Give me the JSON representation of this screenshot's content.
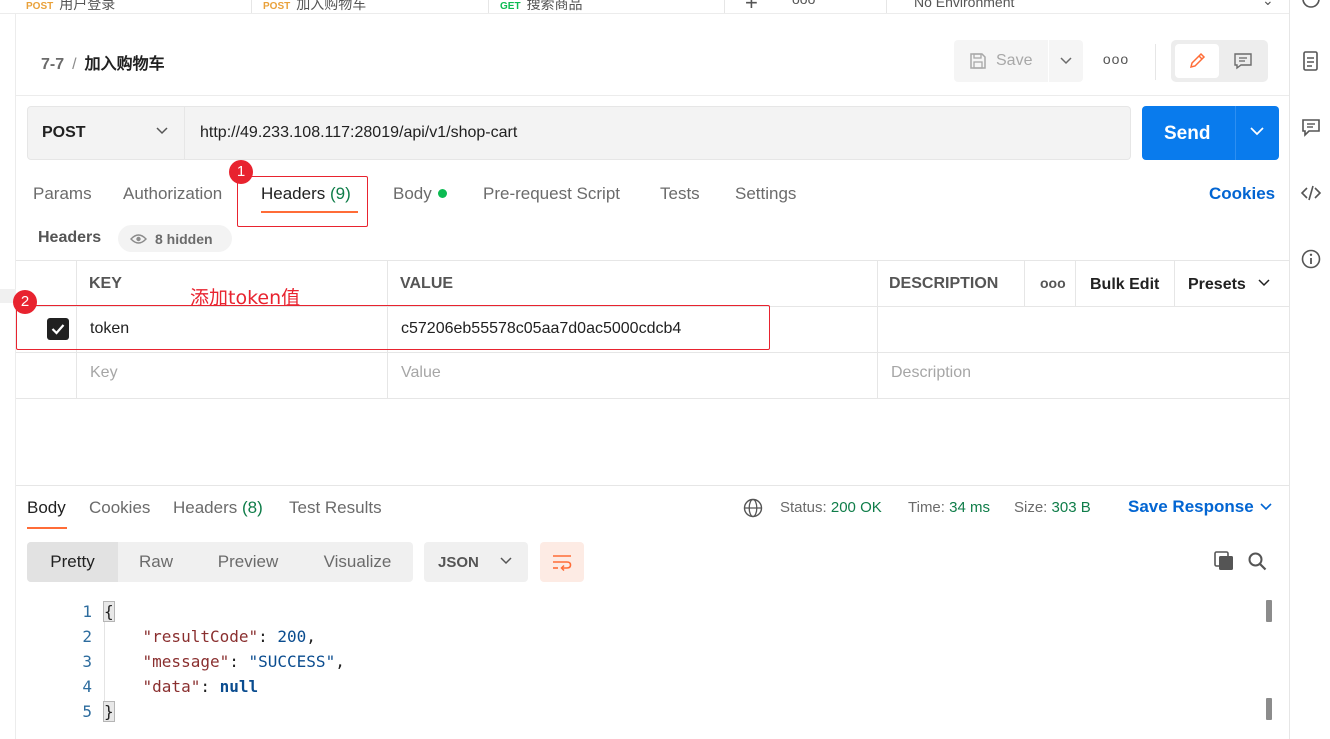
{
  "tabstrip": {
    "tabs": [
      {
        "method": "POST",
        "name": "用户登录",
        "method_color": "#e9a13a"
      },
      {
        "method": "POST",
        "name": "加入购物车",
        "method_color": "#e9a13a"
      },
      {
        "method": "GET",
        "name": "搜索商品",
        "method_color": "#0cbb52"
      }
    ],
    "new_tab_icon": "plus-icon",
    "more_icon": "ellipsis-icon",
    "environment": "No Environment"
  },
  "breadcrumb": {
    "collection": "7-7",
    "request": "加入购物车"
  },
  "toolbar": {
    "save_label": "Save"
  },
  "request": {
    "method": "POST",
    "url": "http://49.233.108.117:28019/api/v1/shop-cart",
    "send_label": "Send"
  },
  "request_tabs": {
    "params": "Params",
    "authorization": "Authorization",
    "headers": "Headers",
    "headers_count": "(9)",
    "body": "Body",
    "prerequest": "Pre-request Script",
    "tests": "Tests",
    "settings": "Settings",
    "cookies": "Cookies"
  },
  "headers_section": {
    "label": "Headers",
    "hidden_label": "8 hidden"
  },
  "headers_table": {
    "columns": {
      "key": "KEY",
      "value": "VALUE",
      "description": "DESCRIPTION"
    },
    "more": "ooo",
    "bulk_edit": "Bulk Edit",
    "presets": "Presets",
    "rows": [
      {
        "checked": true,
        "key": "token",
        "value": "c57206eb55578c05aa7d0ac5000cdcb4",
        "description": ""
      }
    ],
    "placeholder": {
      "key": "Key",
      "value": "Value",
      "description": "Description"
    }
  },
  "annotations": {
    "marker1": "1",
    "marker2": "2",
    "note": "添加token值",
    "color": "#e8232f"
  },
  "response": {
    "tabs": {
      "body": "Body",
      "cookies": "Cookies",
      "headers": "Headers",
      "headers_count": "(8)",
      "test_results": "Test Results"
    },
    "status_label": "Status:",
    "status_value": "200 OK",
    "time_label": "Time:",
    "time_value": "34 ms",
    "size_label": "Size:",
    "size_value": "303 B",
    "save_response": "Save Response",
    "view_modes": [
      "Pretty",
      "Raw",
      "Preview",
      "Visualize"
    ],
    "format": "JSON",
    "code": {
      "line_numbers": [
        "1",
        "2",
        "3",
        "4",
        "5"
      ],
      "open_brace": "{",
      "close_brace": "}",
      "fields": [
        {
          "key": "\"resultCode\"",
          "value": "200",
          "trail": ","
        },
        {
          "key": "\"message\"",
          "value": "\"SUCCESS\"",
          "trail": ","
        },
        {
          "key": "\"data\"",
          "value": "null",
          "trail": ""
        }
      ]
    }
  },
  "colors": {
    "accent": "#ff6c37",
    "send_blue": "#097bed",
    "link_blue": "#0265d2",
    "success_green": "#0f7d49"
  }
}
